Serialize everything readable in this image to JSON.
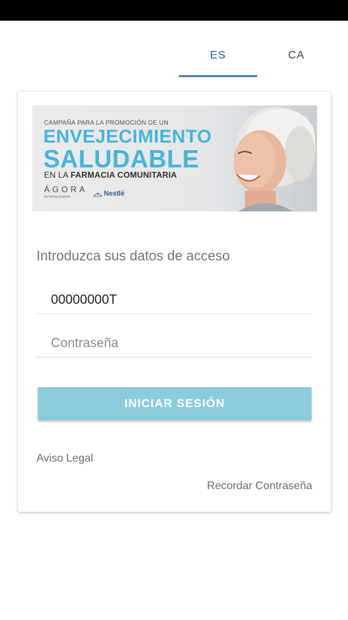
{
  "languages": {
    "es": "ES",
    "ca": "CA",
    "selected": "ES"
  },
  "banner": {
    "line1": "CAMPAÑA PARA LA PROMOCIÓN DE UN",
    "line2": "ENVEJECIMIENTO",
    "line3": "SALUDABLE",
    "line4_prefix": "EN LA ",
    "line4_bold": "FARMACIA COMUNITARIA",
    "logo_agora": "ÁGORA",
    "logo_agora_sub": "de farmacéuticos",
    "logo_nestle": "Nestlé",
    "colors": {
      "accent": "#4ab3d5"
    }
  },
  "login": {
    "intro": "Introduzca sus datos de acceso",
    "username_value": "00000000T",
    "password_placeholder": "Contraseña",
    "submit_label": "INICIAR SESIÓN",
    "button_color": "#8ccbdd"
  },
  "links": {
    "legal": "Aviso Legal",
    "remember": "Recordar Contraseña"
  }
}
